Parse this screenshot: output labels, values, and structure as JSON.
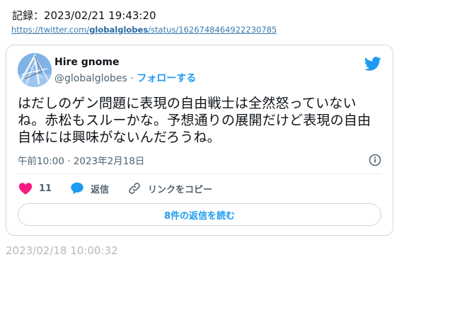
{
  "record": {
    "label": "記録：2023/02/21 19:43:20",
    "url_prefix": "https://twitter.com/",
    "url_handle": "globalglobes",
    "url_suffix": "/status/1626748464922230785"
  },
  "tweet": {
    "author_name": "Hire gnome",
    "author_handle": "@globalglobes",
    "separator": " · ",
    "follow_label": "フォローする",
    "text": "はだしのゲン問題に表現の自由戦士は全然怒っていないね。赤松もスルーかな。予想通りの展開だけど表現の自由自体には興味がないんだろうね。",
    "timestamp": "午前10:00 · 2023年2月18日",
    "likes": "11",
    "reply_label": "返信",
    "copy_link_label": "リンクをコピー",
    "read_replies_label": "8件の返信を読む"
  },
  "archived_at": "2023/02/18 10:00:32",
  "icons": [
    "avatar-image",
    "twitter-bird-icon",
    "info-icon",
    "heart-icon",
    "reply-bubble-icon",
    "link-icon"
  ],
  "colors": {
    "accent": "#1d9bf0",
    "like": "#f91880",
    "muted": "#536471",
    "border": "#cfd9de"
  }
}
